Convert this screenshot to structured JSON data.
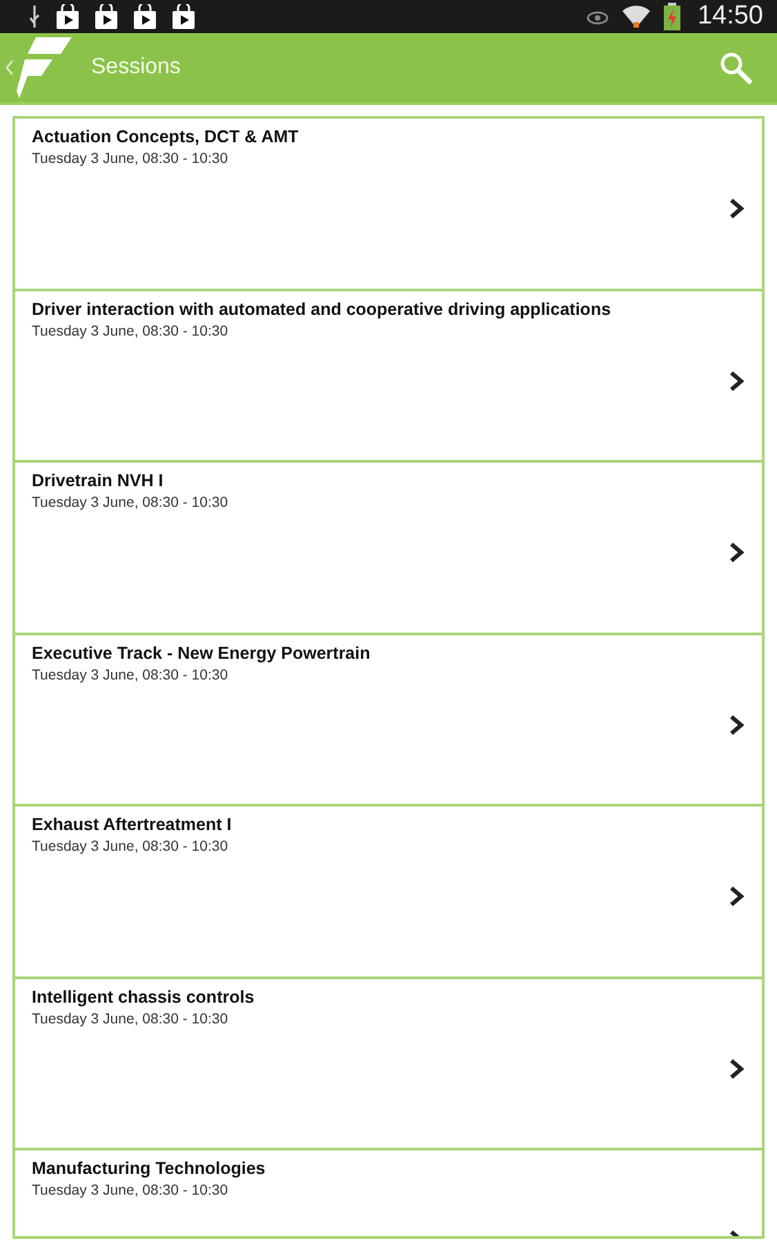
{
  "status_bar": {
    "time": "14:50",
    "notifications": [
      {
        "kind": "store"
      },
      {
        "kind": "store"
      },
      {
        "kind": "store"
      },
      {
        "kind": "store"
      }
    ]
  },
  "app_bar": {
    "title": "Sessions"
  },
  "sessions": [
    {
      "title": "Actuation Concepts, DCT & AMT",
      "time": "Tuesday 3 June, 08:30 - 10:30"
    },
    {
      "title": "Driver interaction with automated and cooperative driving applications",
      "time": "Tuesday 3 June, 08:30 - 10:30"
    },
    {
      "title": "Drivetrain NVH I",
      "time": "Tuesday 3 June, 08:30 - 10:30"
    },
    {
      "title": "Executive Track - New Energy Powertrain",
      "time": "Tuesday 3 June, 08:30 - 10:30"
    },
    {
      "title": "Exhaust Aftertreatment I",
      "time": "Tuesday 3 June, 08:30 - 10:30"
    },
    {
      "title": "Intelligent chassis controls",
      "time": "Tuesday 3 June, 08:30 - 10:30"
    },
    {
      "title": "Manufacturing Technologies",
      "time": "Tuesday 3 June, 08:30 - 10:30"
    }
  ]
}
